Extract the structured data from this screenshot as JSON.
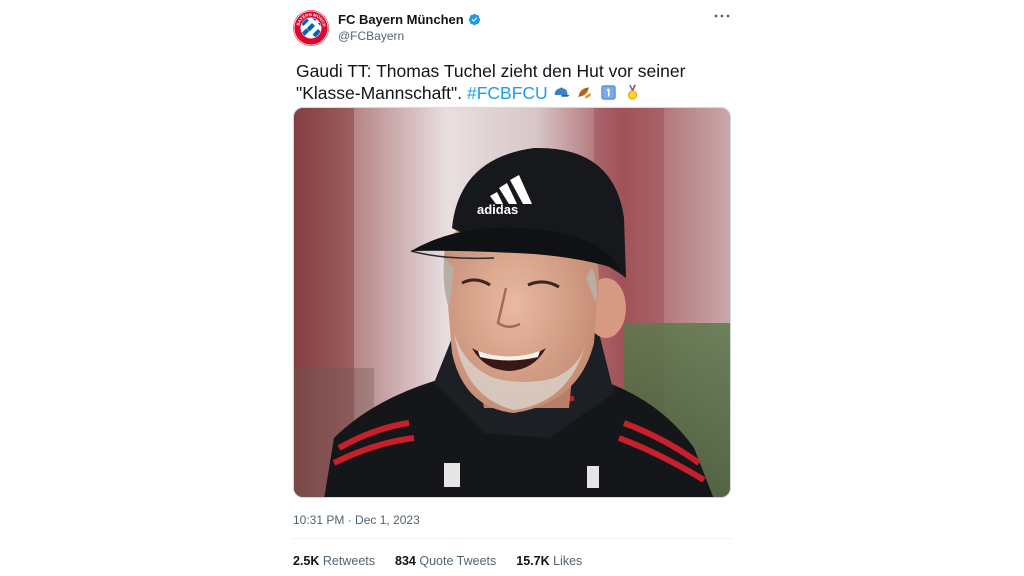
{
  "account": {
    "display_name": "FC Bayern München",
    "handle": "@FCBayern",
    "verified": true,
    "avatar": "fc-bayern-logo",
    "avatar_text": "FC BAYERN MÜNCHEN"
  },
  "tweet": {
    "text": "Gaudi TT: Thomas Tuchel zieht den Hut vor seiner \"Klasse-Mannschaft\".",
    "hashtag": "#FCBFCU",
    "emojis": [
      "cap-emoji",
      "falling-leaf-emoji",
      "keycap-one-emoji",
      "medal-emoji"
    ],
    "media": "photo-smiling-coach-in-black-adidas-cap",
    "timestamp": "10:31 PM · Dec 1, 2023"
  },
  "stats": {
    "retweets_count": "2.5K",
    "retweets_label": "Retweets",
    "quotes_count": "834",
    "quotes_label": "Quote Tweets",
    "likes_count": "15.7K",
    "likes_label": "Likes"
  },
  "colors": {
    "link": "#1d9bf0",
    "text": "#0f1419",
    "secondary": "#536471",
    "bayern_red": "#dc052d",
    "bayern_blue": "#0066b2"
  }
}
